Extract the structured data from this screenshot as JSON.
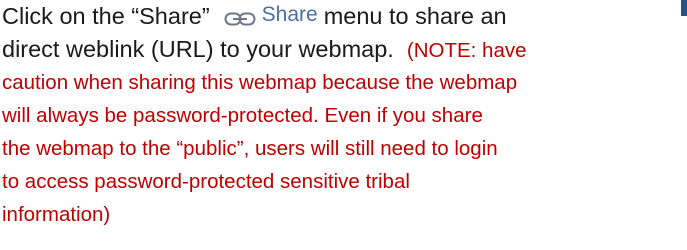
{
  "instruction": {
    "lead": "Click on the “Share”",
    "after_chip": "menu to share an",
    "line2": "direct weblink (URL) to your webmap.",
    "note_start": "(NOTE: have"
  },
  "share_button": {
    "label": "Share",
    "icon": "link-chain-icon"
  },
  "note_lines": [
    "caution when sharing this webmap because the webmap",
    "will always be password-protected.  Even if you share",
    "the webmap to the “public”, users will still need to login",
    "to access password-protected sensitive tribal",
    "information)"
  ],
  "colors": {
    "body_text": "#1a1a1a",
    "note_text": "#c00000",
    "share_label": "#4a6fa5",
    "corner_mark": "#2b4f86"
  }
}
